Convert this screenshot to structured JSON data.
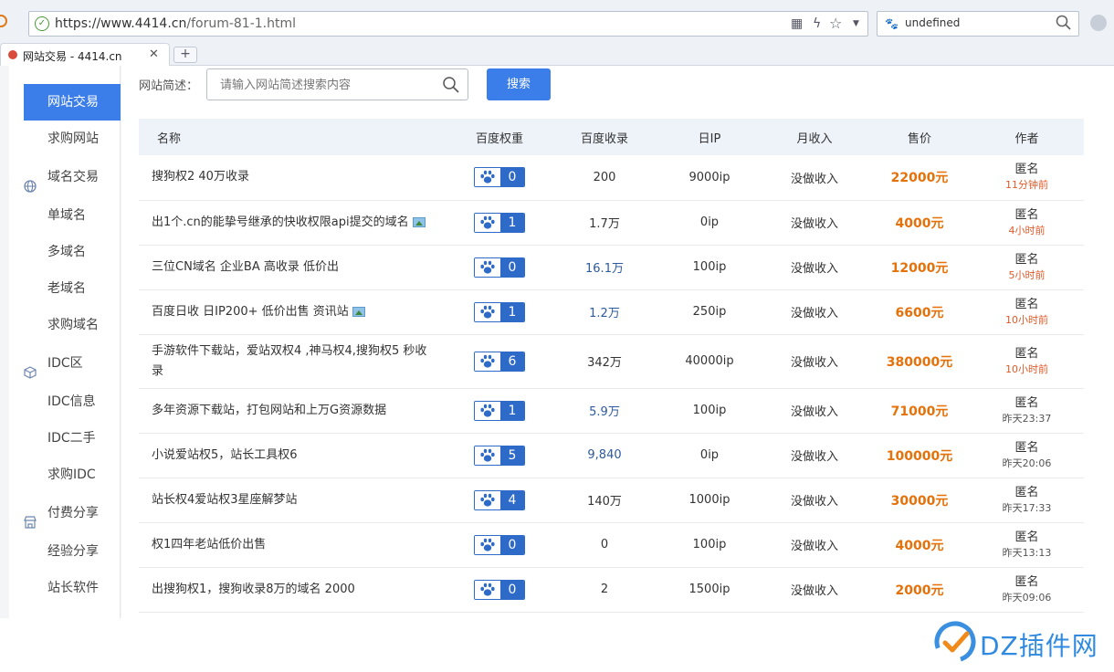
{
  "browser": {
    "url_prefix": "https://www.4414.cn",
    "url_path": "/forum-81-1.html",
    "search_value": "undefined",
    "tab_title": "网站交易 - 4414.cn"
  },
  "sidebar": {
    "items": [
      {
        "label": "网站交易",
        "kind": "item",
        "active": true
      },
      {
        "label": "求购网站",
        "kind": "item"
      },
      {
        "label": "域名交易",
        "kind": "group",
        "icon": "globe-icon"
      },
      {
        "label": "单域名",
        "kind": "item"
      },
      {
        "label": "多域名",
        "kind": "item"
      },
      {
        "label": "老域名",
        "kind": "item"
      },
      {
        "label": "求购域名",
        "kind": "item"
      },
      {
        "label": "IDC区",
        "kind": "group",
        "icon": "cube-icon"
      },
      {
        "label": "IDC信息",
        "kind": "item"
      },
      {
        "label": "IDC二手",
        "kind": "item"
      },
      {
        "label": "求购IDC",
        "kind": "item"
      },
      {
        "label": "付费分享",
        "kind": "group",
        "icon": "shop-icon"
      },
      {
        "label": "经验分享",
        "kind": "item"
      },
      {
        "label": "站长软件",
        "kind": "item"
      }
    ]
  },
  "filter": {
    "label": "网站简述：",
    "placeholder": "请输入网站简述搜索内容",
    "button": "搜索"
  },
  "table": {
    "headers": [
      "名称",
      "百度权重",
      "百度收录",
      "日IP",
      "月收入",
      "售价",
      "作者"
    ],
    "rows": [
      {
        "name": "搜狗权2 40万收录",
        "weight": "0",
        "index": "200",
        "index_blue": false,
        "ip": "9000ip",
        "income": "没做收入",
        "price": "22000元",
        "author": "匿名",
        "time": "11分钟前",
        "time_red": true,
        "pic": false
      },
      {
        "name": "出1个.cn的能挚号继承的快收权限api提交的域名",
        "weight": "1",
        "index": "1.7万",
        "index_blue": false,
        "ip": "0ip",
        "income": "没做收入",
        "price": "4000元",
        "author": "匿名",
        "time": "4小时前",
        "time_red": true,
        "pic": true
      },
      {
        "name": "三位CN域名 企业BA 高收录 低价出",
        "weight": "0",
        "index": "16.1万",
        "index_blue": true,
        "ip": "100ip",
        "income": "没做收入",
        "price": "12000元",
        "author": "匿名",
        "time": "5小时前",
        "time_red": true,
        "pic": false
      },
      {
        "name": "百度日收 日IP200+ 低价出售 资讯站",
        "weight": "1",
        "index": "1.2万",
        "index_blue": true,
        "ip": "250ip",
        "income": "没做收入",
        "price": "6600元",
        "author": "匿名",
        "time": "10小时前",
        "time_red": true,
        "pic": true
      },
      {
        "name": "手游软件下载站，爱站双权4 ,神马权4,搜狗权5 秒收录",
        "weight": "6",
        "index": "342万",
        "index_blue": false,
        "ip": "40000ip",
        "income": "没做收入",
        "price": "380000元",
        "author": "匿名",
        "time": "10小时前",
        "time_red": true,
        "pic": false
      },
      {
        "name": "多年资源下载站，打包网站和上万G资源数据",
        "weight": "1",
        "index": "5.9万",
        "index_blue": true,
        "ip": "100ip",
        "income": "没做收入",
        "price": "71000元",
        "author": "匿名",
        "time": "昨天23:37",
        "time_red": false,
        "pic": false
      },
      {
        "name": "小说爱站权5，站长工具权6",
        "weight": "5",
        "index": "9,840",
        "index_blue": true,
        "ip": "0ip",
        "income": "没做收入",
        "price": "100000元",
        "author": "匿名",
        "time": "昨天20:06",
        "time_red": false,
        "pic": false
      },
      {
        "name": "站长权4爱站权3星座解梦站",
        "weight": "4",
        "index": "140万",
        "index_blue": false,
        "ip": "1000ip",
        "income": "没做收入",
        "price": "30000元",
        "author": "匿名",
        "time": "昨天17:33",
        "time_red": false,
        "pic": false
      },
      {
        "name": "权1四年老站低价出售",
        "weight": "0",
        "index": "0",
        "index_blue": false,
        "ip": "100ip",
        "income": "没做收入",
        "price": "4000元",
        "author": "匿名",
        "time": "昨天13:13",
        "time_red": false,
        "pic": false
      },
      {
        "name": "出搜狗权1，搜狗收录8万的域名 2000",
        "weight": "0",
        "index": "2",
        "index_blue": false,
        "ip": "1500ip",
        "income": "没做收入",
        "price": "2000元",
        "author": "匿名",
        "time": "昨天09:06",
        "time_red": false,
        "pic": false
      }
    ]
  },
  "watermark": {
    "text": "DZ插件网"
  },
  "colors": {
    "accent": "#3b7de9",
    "price": "#e4710a",
    "badge": "#2e6ac8"
  }
}
